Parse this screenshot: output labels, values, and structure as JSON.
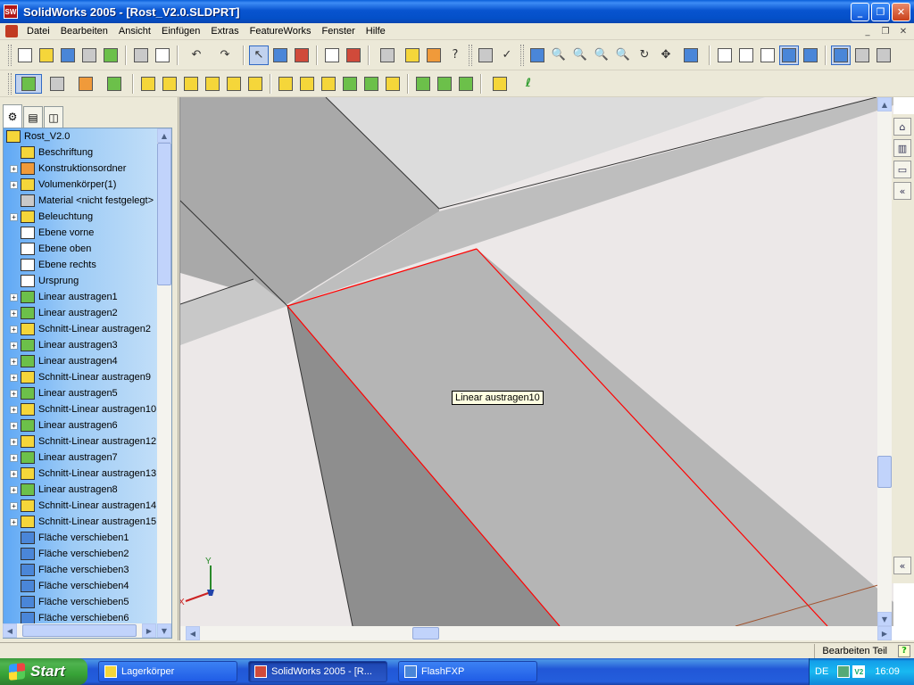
{
  "window": {
    "title": "SolidWorks 2005 - [Rost_V2.0.SLDPRT]",
    "app_icon": "SW",
    "controls": [
      "minimize-icon",
      "restore-icon",
      "close-icon"
    ]
  },
  "menubar": {
    "items": [
      "Datei",
      "Bearbeiten",
      "Ansicht",
      "Einfügen",
      "Extras",
      "FeatureWorks",
      "Fenster",
      "Hilfe"
    ],
    "mdi_controls": [
      "_",
      "❐",
      "✕"
    ]
  },
  "toolbar1": {
    "icons": [
      "new-icon",
      "open-icon",
      "save-icon",
      "print-preview-icon",
      "print-icon",
      "undo-icon",
      "redo-icon",
      "select-icon",
      "sketch-icon",
      "rebuild-icon",
      "options-icon",
      "grid-icon",
      "help-icon",
      "zoom-fit-icon",
      "zoom-area-icon",
      "zoom-in-icon",
      "zoom-selection-icon",
      "rotate-icon",
      "pan-icon",
      "view-orientation-icon",
      "wireframe-icon",
      "hidden-lines-icon",
      "shaded-icon"
    ]
  },
  "toolbar2": {
    "icons": [
      "extrude-boss-icon",
      "revolve-icon",
      "sweep-icon",
      "loft-icon",
      "cut-icon",
      "fillet-icon",
      "chamfer-icon",
      "shell-icon",
      "rib-icon",
      "pattern-icon",
      "mirror-icon",
      "reference-geometry-icon",
      "curves-icon"
    ]
  },
  "tree_tabs": [
    "featuremanager-tab",
    "propertymanager-tab",
    "configurationmanager-tab"
  ],
  "tree": {
    "root": "Rost_V2.0",
    "items": [
      {
        "label": "Beschriftung",
        "expandable": false,
        "icon": "annotations-icon"
      },
      {
        "label": "Konstruktionsordner",
        "expandable": true,
        "icon": "design-binder-icon"
      },
      {
        "label": "Volumenkörper(1)",
        "expandable": true,
        "icon": "solid-bodies-icon"
      },
      {
        "label": "Material <nicht festgelegt>",
        "expandable": false,
        "icon": "material-icon"
      },
      {
        "label": "Beleuchtung",
        "expandable": true,
        "icon": "lighting-icon"
      },
      {
        "label": "Ebene vorne",
        "expandable": false,
        "icon": "plane-icon"
      },
      {
        "label": "Ebene oben",
        "expandable": false,
        "icon": "plane-icon"
      },
      {
        "label": "Ebene rechts",
        "expandable": false,
        "icon": "plane-icon"
      },
      {
        "label": "Ursprung",
        "expandable": false,
        "icon": "origin-icon"
      },
      {
        "label": "Linear austragen1",
        "expandable": true,
        "icon": "extrude-icon"
      },
      {
        "label": "Linear austragen2",
        "expandable": true,
        "icon": "extrude-icon"
      },
      {
        "label": "Schnitt-Linear austragen2",
        "expandable": true,
        "icon": "cut-extrude-icon"
      },
      {
        "label": "Linear austragen3",
        "expandable": true,
        "icon": "extrude-icon"
      },
      {
        "label": "Linear austragen4",
        "expandable": true,
        "icon": "extrude-icon"
      },
      {
        "label": "Schnitt-Linear austragen9",
        "expandable": true,
        "icon": "cut-extrude-icon"
      },
      {
        "label": "Linear austragen5",
        "expandable": true,
        "icon": "extrude-icon"
      },
      {
        "label": "Schnitt-Linear austragen10",
        "expandable": true,
        "icon": "cut-extrude-icon"
      },
      {
        "label": "Linear austragen6",
        "expandable": true,
        "icon": "extrude-icon"
      },
      {
        "label": "Schnitt-Linear austragen12",
        "expandable": true,
        "icon": "cut-extrude-icon"
      },
      {
        "label": "Linear austragen7",
        "expandable": true,
        "icon": "extrude-icon"
      },
      {
        "label": "Schnitt-Linear austragen13",
        "expandable": true,
        "icon": "cut-extrude-icon"
      },
      {
        "label": "Linear austragen8",
        "expandable": true,
        "icon": "extrude-icon"
      },
      {
        "label": "Schnitt-Linear austragen14",
        "expandable": true,
        "icon": "cut-extrude-icon"
      },
      {
        "label": "Schnitt-Linear austragen15",
        "expandable": true,
        "icon": "cut-extrude-icon"
      },
      {
        "label": "Fläche verschieben1",
        "expandable": false,
        "icon": "move-face-icon"
      },
      {
        "label": "Fläche verschieben2",
        "expandable": false,
        "icon": "move-face-icon"
      },
      {
        "label": "Fläche verschieben3",
        "expandable": false,
        "icon": "move-face-icon"
      },
      {
        "label": "Fläche verschieben4",
        "expandable": false,
        "icon": "move-face-icon"
      },
      {
        "label": "Fläche verschieben5",
        "expandable": false,
        "icon": "move-face-icon"
      },
      {
        "label": "Fläche verschieben6",
        "expandable": false,
        "icon": "move-face-icon"
      }
    ]
  },
  "viewport": {
    "tooltip": "Linear austragen10",
    "triad": {
      "x": "X",
      "y": "Y"
    }
  },
  "statusbar": {
    "text": "Bearbeiten Teil",
    "help": "?"
  },
  "taskbar": {
    "start": "Start",
    "tasks": [
      {
        "label": "Lagerkörper",
        "active": false
      },
      {
        "label": "SolidWorks 2005 - [R...",
        "active": true
      },
      {
        "label": "FlashFXP",
        "active": false
      }
    ],
    "tray": {
      "lang": "DE",
      "clock": "16:09",
      "tray_icon": "V2"
    }
  },
  "colors": {
    "tree_gradient_start": "#5fa8f5",
    "tree_gradient_end": "#c7e1f8",
    "selection_edge": "#ff0000",
    "titlebar": "#0a5fd8"
  }
}
